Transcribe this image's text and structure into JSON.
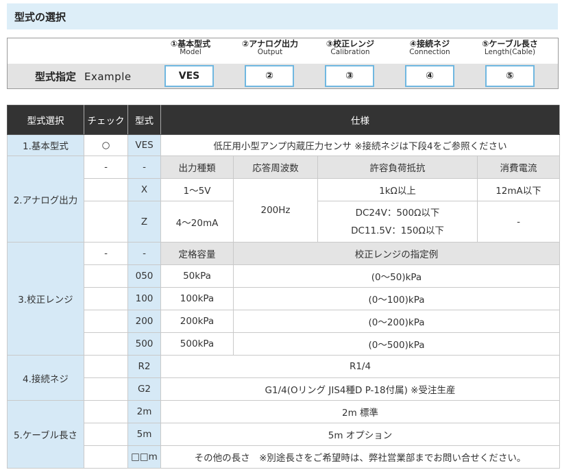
{
  "header": {
    "title": "型式の選択"
  },
  "example": {
    "label": "型式指定",
    "label_en": "Example",
    "steps": [
      {
        "jp": "①基本型式",
        "en": "Model",
        "code": "VES"
      },
      {
        "jp": "②アナログ出力",
        "en": "Output",
        "code": "②"
      },
      {
        "jp": "③校正レンジ",
        "en": "Calibration",
        "code": "③"
      },
      {
        "jp": "④接続ネジ",
        "en": "Connection",
        "code": "④"
      },
      {
        "jp": "⑤ケーブル長さ",
        "en": "Length(Cable)",
        "code": "⑤"
      }
    ]
  },
  "table": {
    "headers": {
      "select": "型式選択",
      "check": "チェック",
      "model": "型式",
      "spec": "仕様"
    },
    "basic": {
      "category": "1.基本型式",
      "check": "○",
      "code": "VES",
      "description": "低圧用小型アンプ内蔵圧力センサ ※接続ネジは下段4をご参照ください"
    },
    "analog": {
      "category": "2.アナログ出力",
      "dash": "-",
      "subheaders": {
        "output_type": "出力種類",
        "frequency": "応答周波数",
        "load": "許容負荷抵抗",
        "current": "消費電流"
      },
      "frequency": "200Hz",
      "rows": [
        {
          "code": "X",
          "output_type": "1～5V",
          "load": "1kΩ以上",
          "current": "12mA以下"
        },
        {
          "code": "Z",
          "output_type": "4～20mA",
          "load_line1": "DC24V：500Ω以下",
          "load_line2": "DC11.5V：150Ω以下",
          "current": "-"
        }
      ]
    },
    "range": {
      "category": "3.校正レンジ",
      "dash": "-",
      "subheaders": {
        "rated": "定格容量",
        "example": "校正レンジの指定例"
      },
      "rows": [
        {
          "code": "050",
          "rated": "50kPa",
          "example": "(0～50)kPa"
        },
        {
          "code": "100",
          "rated": "100kPa",
          "example": "(0～100)kPa"
        },
        {
          "code": "200",
          "rated": "200kPa",
          "example": "(0～200)kPa"
        },
        {
          "code": "500",
          "rated": "500kPa",
          "example": "(0～500)kPa"
        }
      ]
    },
    "connection": {
      "category": "4.接続ネジ",
      "rows": [
        {
          "code": "R2",
          "spec": "R1/4"
        },
        {
          "code": "G2",
          "spec": "G1/4(Oリング JIS4種D P-18付属) ※受注生産"
        }
      ]
    },
    "cable": {
      "category": "5.ケーブル長さ",
      "rows": [
        {
          "code": "2m",
          "spec": "2m 標準"
        },
        {
          "code": "5m",
          "spec": "5m オプション"
        },
        {
          "code": "□□m",
          "spec": "その他の長さ　※別途長さをご希望時は、弊社営業部までお問い合せください。"
        }
      ]
    }
  }
}
